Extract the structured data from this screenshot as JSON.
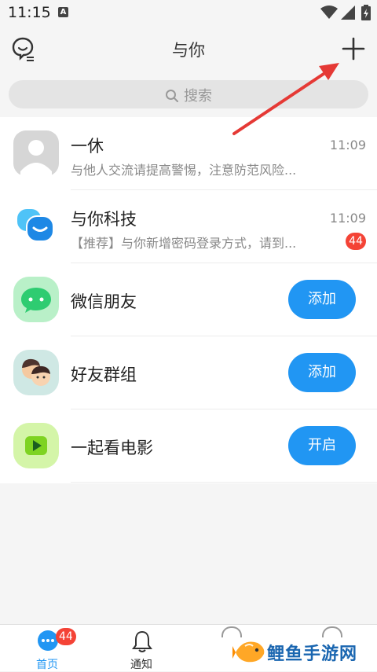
{
  "status_bar": {
    "time": "11:15",
    "notification_icon": "A"
  },
  "header": {
    "title": "与你"
  },
  "search": {
    "placeholder": "搜索"
  },
  "rows": [
    {
      "name": "一休",
      "time": "11:09",
      "message": "与他人交流请提高警惕，注意防范风险..."
    },
    {
      "name": "与你科技",
      "time": "11:09",
      "message": "【推荐】与你新增密码登录方式，请到...",
      "badge": "44"
    },
    {
      "name": "微信朋友",
      "button": "添加"
    },
    {
      "name": "好友群组",
      "button": "添加"
    },
    {
      "name": "一起看电影",
      "button": "开启"
    }
  ],
  "bottom_nav": {
    "home": {
      "label": "首页",
      "badge": "44"
    },
    "notify": {
      "label": "通知"
    }
  },
  "watermark": {
    "text": "鲤鱼手游网"
  },
  "colors": {
    "accent": "#2196f3",
    "badge": "#f44336",
    "annotation_arrow": "#e53935"
  }
}
